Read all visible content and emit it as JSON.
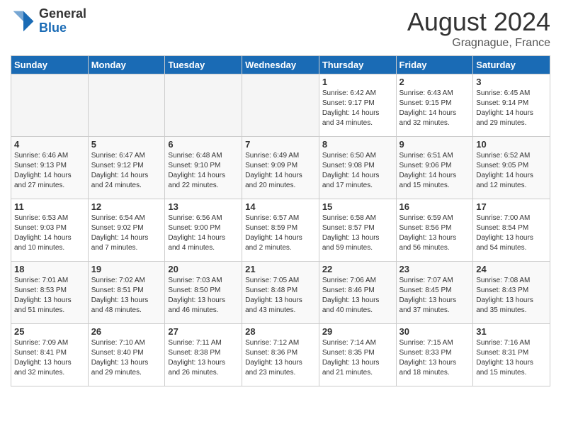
{
  "logo": {
    "general": "General",
    "blue": "Blue"
  },
  "title": "August 2024",
  "location": "Gragnague, France",
  "days_of_week": [
    "Sunday",
    "Monday",
    "Tuesday",
    "Wednesday",
    "Thursday",
    "Friday",
    "Saturday"
  ],
  "weeks": [
    [
      {
        "num": "",
        "info": ""
      },
      {
        "num": "",
        "info": ""
      },
      {
        "num": "",
        "info": ""
      },
      {
        "num": "",
        "info": ""
      },
      {
        "num": "1",
        "info": "Sunrise: 6:42 AM\nSunset: 9:17 PM\nDaylight: 14 hours\nand 34 minutes."
      },
      {
        "num": "2",
        "info": "Sunrise: 6:43 AM\nSunset: 9:15 PM\nDaylight: 14 hours\nand 32 minutes."
      },
      {
        "num": "3",
        "info": "Sunrise: 6:45 AM\nSunset: 9:14 PM\nDaylight: 14 hours\nand 29 minutes."
      }
    ],
    [
      {
        "num": "4",
        "info": "Sunrise: 6:46 AM\nSunset: 9:13 PM\nDaylight: 14 hours\nand 27 minutes."
      },
      {
        "num": "5",
        "info": "Sunrise: 6:47 AM\nSunset: 9:12 PM\nDaylight: 14 hours\nand 24 minutes."
      },
      {
        "num": "6",
        "info": "Sunrise: 6:48 AM\nSunset: 9:10 PM\nDaylight: 14 hours\nand 22 minutes."
      },
      {
        "num": "7",
        "info": "Sunrise: 6:49 AM\nSunset: 9:09 PM\nDaylight: 14 hours\nand 20 minutes."
      },
      {
        "num": "8",
        "info": "Sunrise: 6:50 AM\nSunset: 9:08 PM\nDaylight: 14 hours\nand 17 minutes."
      },
      {
        "num": "9",
        "info": "Sunrise: 6:51 AM\nSunset: 9:06 PM\nDaylight: 14 hours\nand 15 minutes."
      },
      {
        "num": "10",
        "info": "Sunrise: 6:52 AM\nSunset: 9:05 PM\nDaylight: 14 hours\nand 12 minutes."
      }
    ],
    [
      {
        "num": "11",
        "info": "Sunrise: 6:53 AM\nSunset: 9:03 PM\nDaylight: 14 hours\nand 10 minutes."
      },
      {
        "num": "12",
        "info": "Sunrise: 6:54 AM\nSunset: 9:02 PM\nDaylight: 14 hours\nand 7 minutes."
      },
      {
        "num": "13",
        "info": "Sunrise: 6:56 AM\nSunset: 9:00 PM\nDaylight: 14 hours\nand 4 minutes."
      },
      {
        "num": "14",
        "info": "Sunrise: 6:57 AM\nSunset: 8:59 PM\nDaylight: 14 hours\nand 2 minutes."
      },
      {
        "num": "15",
        "info": "Sunrise: 6:58 AM\nSunset: 8:57 PM\nDaylight: 13 hours\nand 59 minutes."
      },
      {
        "num": "16",
        "info": "Sunrise: 6:59 AM\nSunset: 8:56 PM\nDaylight: 13 hours\nand 56 minutes."
      },
      {
        "num": "17",
        "info": "Sunrise: 7:00 AM\nSunset: 8:54 PM\nDaylight: 13 hours\nand 54 minutes."
      }
    ],
    [
      {
        "num": "18",
        "info": "Sunrise: 7:01 AM\nSunset: 8:53 PM\nDaylight: 13 hours\nand 51 minutes."
      },
      {
        "num": "19",
        "info": "Sunrise: 7:02 AM\nSunset: 8:51 PM\nDaylight: 13 hours\nand 48 minutes."
      },
      {
        "num": "20",
        "info": "Sunrise: 7:03 AM\nSunset: 8:50 PM\nDaylight: 13 hours\nand 46 minutes."
      },
      {
        "num": "21",
        "info": "Sunrise: 7:05 AM\nSunset: 8:48 PM\nDaylight: 13 hours\nand 43 minutes."
      },
      {
        "num": "22",
        "info": "Sunrise: 7:06 AM\nSunset: 8:46 PM\nDaylight: 13 hours\nand 40 minutes."
      },
      {
        "num": "23",
        "info": "Sunrise: 7:07 AM\nSunset: 8:45 PM\nDaylight: 13 hours\nand 37 minutes."
      },
      {
        "num": "24",
        "info": "Sunrise: 7:08 AM\nSunset: 8:43 PM\nDaylight: 13 hours\nand 35 minutes."
      }
    ],
    [
      {
        "num": "25",
        "info": "Sunrise: 7:09 AM\nSunset: 8:41 PM\nDaylight: 13 hours\nand 32 minutes."
      },
      {
        "num": "26",
        "info": "Sunrise: 7:10 AM\nSunset: 8:40 PM\nDaylight: 13 hours\nand 29 minutes."
      },
      {
        "num": "27",
        "info": "Sunrise: 7:11 AM\nSunset: 8:38 PM\nDaylight: 13 hours\nand 26 minutes."
      },
      {
        "num": "28",
        "info": "Sunrise: 7:12 AM\nSunset: 8:36 PM\nDaylight: 13 hours\nand 23 minutes."
      },
      {
        "num": "29",
        "info": "Sunrise: 7:14 AM\nSunset: 8:35 PM\nDaylight: 13 hours\nand 21 minutes."
      },
      {
        "num": "30",
        "info": "Sunrise: 7:15 AM\nSunset: 8:33 PM\nDaylight: 13 hours\nand 18 minutes."
      },
      {
        "num": "31",
        "info": "Sunrise: 7:16 AM\nSunset: 8:31 PM\nDaylight: 13 hours\nand 15 minutes."
      }
    ]
  ]
}
